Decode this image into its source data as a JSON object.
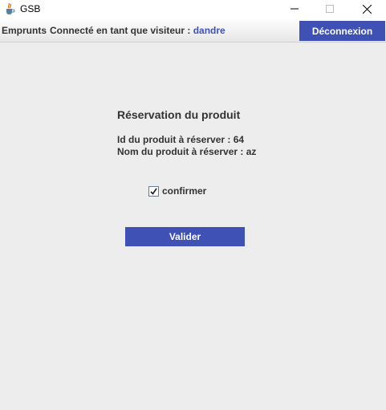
{
  "window": {
    "title": "GSB",
    "icon": "java-cup-icon",
    "controls": [
      "minimize-icon",
      "maximize-icon",
      "close-icon"
    ]
  },
  "toolbar": {
    "section_label": "Emprunts",
    "connected_prefix": "Connecté en tant que visiteur :",
    "username": "dandre",
    "logout_label": "Déconnexion"
  },
  "reservation": {
    "heading": "Réservation du produit",
    "id_line": "Id du produit à réserver : 64",
    "name_line": "Nom du produit à réserver : az",
    "confirm_label": "confirmer",
    "confirm_checked": true,
    "submit_label": "Valider"
  },
  "colors": {
    "accent": "#3f51b5",
    "background": "#ededed",
    "text": "#333333"
  }
}
